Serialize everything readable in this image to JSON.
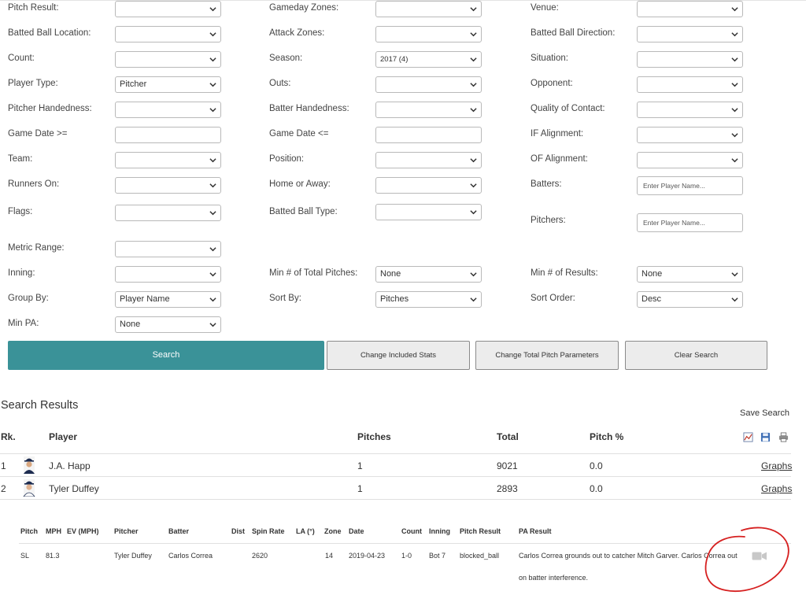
{
  "filters": {
    "pitch_result": {
      "label": "Pitch Result:",
      "value": ""
    },
    "gameday_zones": {
      "label": "Gameday Zones:",
      "value": ""
    },
    "venue": {
      "label": "Venue:",
      "value": ""
    },
    "batted_ball_location": {
      "label": "Batted Ball Location:",
      "value": ""
    },
    "attack_zones": {
      "label": "Attack Zones:",
      "value": ""
    },
    "batted_ball_direction": {
      "label": "Batted Ball Direction:",
      "value": ""
    },
    "count": {
      "label": "Count:",
      "value": ""
    },
    "season": {
      "label": "Season:",
      "value": "2017 (4)"
    },
    "situation": {
      "label": "Situation:",
      "value": ""
    },
    "player_type": {
      "label": "Player Type:",
      "value": "Pitcher"
    },
    "outs": {
      "label": "Outs:",
      "value": ""
    },
    "opponent": {
      "label": "Opponent:",
      "value": ""
    },
    "pitcher_handedness": {
      "label": "Pitcher Handedness:",
      "value": ""
    },
    "batter_handedness": {
      "label": "Batter Handedness:",
      "value": ""
    },
    "quality_of_contact": {
      "label": "Quality of Contact:",
      "value": ""
    },
    "game_date_gte": {
      "label": "Game Date >=",
      "value": ""
    },
    "game_date_lte": {
      "label": "Game Date <=",
      "value": ""
    },
    "if_alignment": {
      "label": "IF Alignment:",
      "value": ""
    },
    "team": {
      "label": "Team:",
      "value": ""
    },
    "position": {
      "label": "Position:",
      "value": ""
    },
    "of_alignment": {
      "label": "OF Alignment:",
      "value": ""
    },
    "runners_on": {
      "label": "Runners On:",
      "value": ""
    },
    "home_or_away": {
      "label": "Home or Away:",
      "value": ""
    },
    "batters": {
      "label": "Batters:",
      "placeholder": "Enter Player Name..."
    },
    "flags": {
      "label": "Flags:",
      "value": ""
    },
    "batted_ball_type": {
      "label": "Batted Ball Type:",
      "value": ""
    },
    "pitchers": {
      "label": "Pitchers:",
      "placeholder": "Enter Player Name..."
    },
    "metric_range": {
      "label": "Metric Range:",
      "value": ""
    },
    "inning": {
      "label": "Inning:",
      "value": ""
    },
    "min_total_pitches": {
      "label": "Min # of Total Pitches:",
      "value": "None"
    },
    "min_results": {
      "label": "Min # of Results:",
      "value": "None"
    },
    "group_by": {
      "label": "Group By:",
      "value": "Player Name"
    },
    "sort_by": {
      "label": "Sort By:",
      "value": "Pitches"
    },
    "sort_order": {
      "label": "Sort Order:",
      "value": "Desc"
    },
    "min_pa": {
      "label": "Min PA:",
      "value": "None"
    }
  },
  "buttons": {
    "search": "Search",
    "change_included_stats": "Change Included Stats",
    "change_total_pitch_parameters": "Change Total Pitch Parameters",
    "clear_search": "Clear Search"
  },
  "results": {
    "heading": "Search Results",
    "save_search": "Save Search",
    "columns": {
      "rank": "Rk.",
      "player": "Player",
      "pitches": "Pitches",
      "total": "Total",
      "pitch_pct": "Pitch %"
    },
    "toolbar_icons": [
      "chart-icon",
      "save-icon",
      "print-icon"
    ],
    "rows": [
      {
        "rank": "1",
        "player": "J.A. Happ",
        "pitches": "1",
        "total": "9021",
        "pitch_pct": "0.0",
        "graphs": "Graphs"
      },
      {
        "rank": "2",
        "player": "Tyler Duffey",
        "pitches": "1",
        "total": "2893",
        "pitch_pct": "0.0",
        "graphs": "Graphs"
      }
    ]
  },
  "pitch_detail": {
    "columns": {
      "pitch": "Pitch",
      "mph": "MPH",
      "ev": "EV (MPH)",
      "pitcher": "Pitcher",
      "batter": "Batter",
      "dist": "Dist",
      "spin_rate": "Spin Rate",
      "la": "LA (°)",
      "zone": "Zone",
      "date": "Date",
      "count": "Count",
      "inning": "Inning",
      "pitch_result": "Pitch Result",
      "pa_result": "PA Result"
    },
    "row": {
      "pitch": "SL",
      "mph": "81.3",
      "ev": "",
      "pitcher": "Tyler Duffey",
      "batter": "Carlos Correa",
      "dist": "",
      "spin_rate": "2620",
      "la": "",
      "zone": "14",
      "date": "2019-04-23",
      "count": "1-0",
      "inning": "Bot 7",
      "pitch_result": "blocked_ball",
      "pa_result_line1": "Carlos Correa grounds out to catcher Mitch Garver. Carlos Correa out",
      "pa_result_line2": "on batter interference.",
      "video_icon": "video-camera-icon"
    }
  },
  "annotation": {
    "color": "#d62020",
    "shape": "hand-drawn red circle around video icon"
  },
  "colors": {
    "accent": "#3a9298",
    "annotation": "#d62020"
  }
}
